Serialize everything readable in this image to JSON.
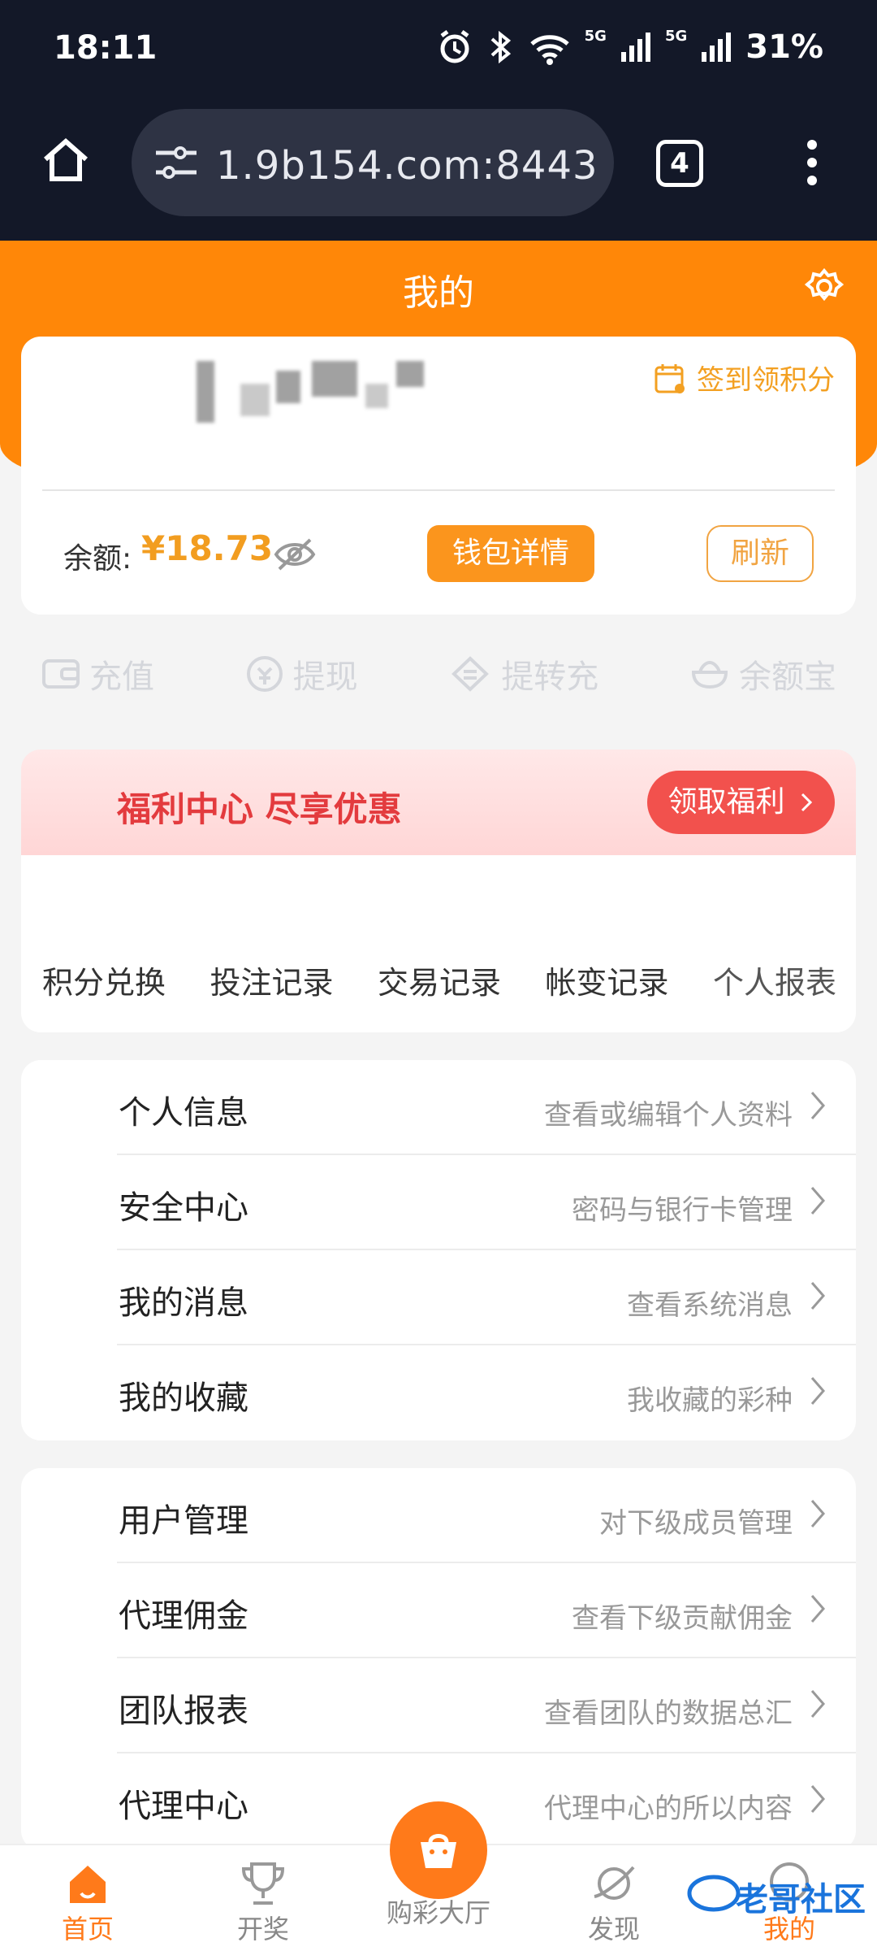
{
  "status_bar": {
    "time": "18:11",
    "network": "5G",
    "network2": "5G",
    "battery": "31%"
  },
  "browser": {
    "url": "1.9b154.com:8443",
    "tabs": "4"
  },
  "header": {
    "title": "我的"
  },
  "profile": {
    "signin": "签到领积分",
    "balance_label": "余额:",
    "balance_value": "¥18.73",
    "wallet_button": "钱包详情",
    "refresh_button": "刷新"
  },
  "actions": [
    {
      "label": "充值"
    },
    {
      "label": "提现"
    },
    {
      "label": "提转充"
    },
    {
      "label": "余额宝"
    }
  ],
  "welfare": {
    "title": "福利中心 尽享优惠",
    "button": "领取福利"
  },
  "shortcuts": [
    {
      "label": "积分兑换"
    },
    {
      "label": "投注记录"
    },
    {
      "label": "交易记录"
    },
    {
      "label": "帐变记录"
    },
    {
      "label": "个人报表"
    }
  ],
  "menu1": [
    {
      "label": "个人信息",
      "desc": "查看或编辑个人资料"
    },
    {
      "label": "安全中心",
      "desc": "密码与银行卡管理"
    },
    {
      "label": "我的消息",
      "desc": "查看系统消息"
    },
    {
      "label": "我的收藏",
      "desc": "我收藏的彩种"
    }
  ],
  "menu2": [
    {
      "label": "用户管理",
      "desc": "对下级成员管理"
    },
    {
      "label": "代理佣金",
      "desc": "查看下级贡献佣金"
    },
    {
      "label": "团队报表",
      "desc": "查看团队的数据总汇"
    },
    {
      "label": "代理中心",
      "desc": "代理中心的所以内容"
    }
  ],
  "bottom_nav": [
    {
      "label": "首页"
    },
    {
      "label": "开奖"
    },
    {
      "label": "购彩大厅"
    },
    {
      "label": "发现"
    },
    {
      "label": "我的"
    }
  ],
  "watermark": "老哥社区",
  "colors": {
    "accent": "#ff8708",
    "dark": "#131828",
    "red": "#f2514d"
  }
}
